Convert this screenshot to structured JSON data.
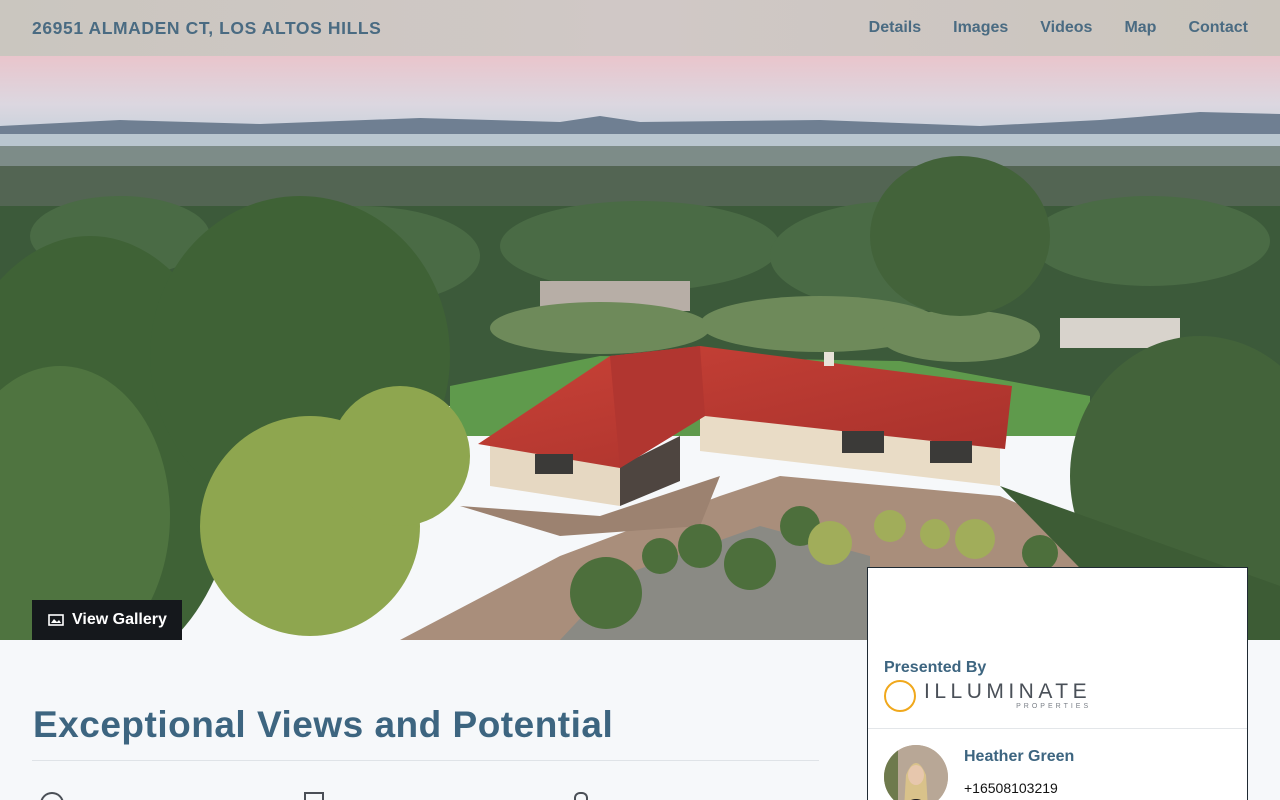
{
  "header": {
    "address": "26951 ALMADEN CT, LOS ALTOS HILLS",
    "nav": [
      "Details",
      "Images",
      "Videos",
      "Map",
      "Contact"
    ]
  },
  "hero": {
    "gallery_label": "View Gallery",
    "image_icon": "image-icon"
  },
  "listing": {
    "title": "Exceptional Views and Potential"
  },
  "agent_card": {
    "presented_by": "Presented By",
    "brand_name": "ILLUMINATE",
    "brand_sub": "PROPERTIES",
    "agent_name": "Heather Green",
    "agent_phone": "+16508103219"
  },
  "colors": {
    "accent": "#3d6580",
    "roof": "#c53b33",
    "logo_ring": "#f0a81c"
  }
}
